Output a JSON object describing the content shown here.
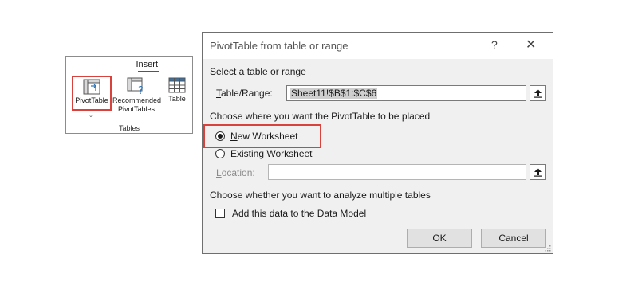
{
  "ribbon": {
    "tab_label": "Insert",
    "pivot_table_label": "PivotTable",
    "recommended_label_line1": "Recommended",
    "recommended_label_line2": "PivotTables",
    "table_label": "Table",
    "group_label": "Tables",
    "accent_color": "#217346",
    "highlight_color": "#d9413d"
  },
  "dialog": {
    "title": "PivotTable from table or range",
    "help_icon": "?",
    "close_icon": "✕",
    "section_select": "Select a table or range",
    "table_range_label_u": "T",
    "table_range_label_rest": "able/Range:",
    "table_range_value": "Sheet11!$B$1:$C$6",
    "section_placement": "Choose where you want the PivotTable to be placed",
    "new_worksheet_u": "N",
    "new_worksheet_rest": "ew Worksheet",
    "existing_worksheet_u": "E",
    "existing_worksheet_rest": "xisting Worksheet",
    "location_label_u": "L",
    "location_label_rest": "ocation:",
    "location_value": "",
    "section_multiple": "Choose whether you want to analyze multiple tables",
    "data_model_label": "Add this data to the Data Model",
    "ok_label": "OK",
    "cancel_label": "Cancel",
    "selected_placement": "New Worksheet"
  }
}
